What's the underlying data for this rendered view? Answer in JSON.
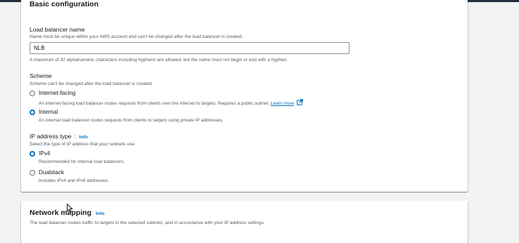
{
  "basic": {
    "title": "Basic configuration",
    "lb_name_label": "Load balancer name",
    "lb_name_desc": "Name must be unique within your AWS account and can't be changed after the load balancer is created.",
    "lb_name_value": "NLB",
    "lb_name_constraint": "A maximum of 32 alphanumeric characters including hyphens are allowed, but the name must not begin or end with a hyphen.",
    "scheme_label": "Scheme",
    "scheme_desc": "Scheme can't be changed after the load balancer is created.",
    "scheme_options": [
      {
        "label": "Internet-facing",
        "desc": "An internet-facing load balancer routes requests from clients over the internet to targets. Requires a public subnet.",
        "link": "Learn more",
        "checked": false
      },
      {
        "label": "Internal",
        "desc": "An internal load balancer routes requests from clients to targets using private IP addresses.",
        "checked": true
      }
    ],
    "ip_label": "IP address type",
    "ip_info": "Info",
    "ip_desc": "Select the type of IP address that your subnets use.",
    "ip_options": [
      {
        "label": "IPv4",
        "desc": "Recommended for internal load balancers.",
        "checked": true
      },
      {
        "label": "Dualstack",
        "desc": "Includes IPv4 and IPv6 addresses.",
        "checked": false
      }
    ]
  },
  "network": {
    "title": "Network mapping",
    "info": "Info",
    "desc": "The load balancer routes traffic to targets in the selected subnets, and in accordance with your IP address settings."
  },
  "colors": {
    "accent": "#0073bb",
    "page_bg": "#f2f3f3",
    "topbar": "#232f3e"
  }
}
